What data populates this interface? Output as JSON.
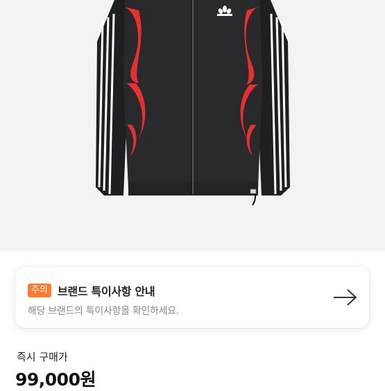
{
  "notice": {
    "badge": "주의",
    "title": "브랜드 특이사항 안내",
    "subtitle": "해당 브랜드의 특이사항을 확인하세요.",
    "icon": "arrow-right-icon"
  },
  "price": {
    "label": "즉시 구매가",
    "value": "99,000원"
  },
  "colors": {
    "accent": "#ff7a2e",
    "jacket_body": "#2a2a2c",
    "jacket_stripe_red": "#e8302e",
    "background": "#f3f3f3"
  }
}
